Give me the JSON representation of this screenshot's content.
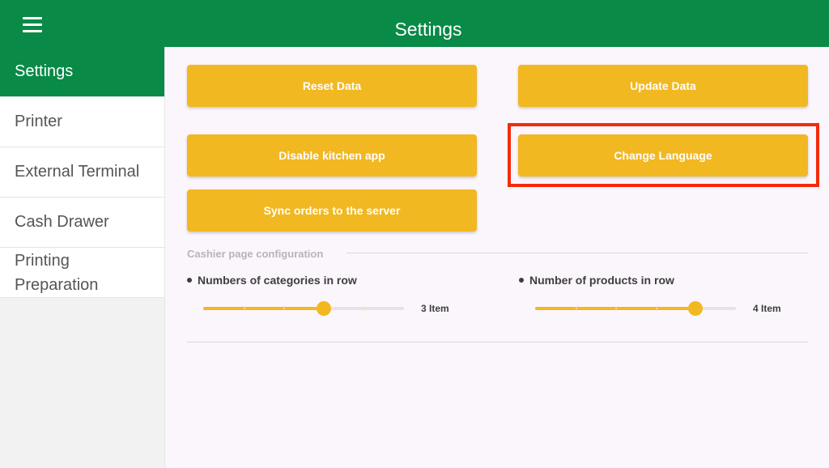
{
  "header": {
    "title": "Settings",
    "background_color": "#098a47",
    "menu_icon": "hamburger-menu-icon"
  },
  "sidebar": {
    "items": [
      {
        "label": "Settings",
        "active": true
      },
      {
        "label": "Printer",
        "active": false
      },
      {
        "label": "External Terminal",
        "active": false
      },
      {
        "label": "Cash Drawer",
        "active": false
      },
      {
        "label": "Printing Preparation",
        "active": false
      }
    ]
  },
  "actions": {
    "reset_data": "Reset Data",
    "update_data": "Update Data",
    "disable_kitchen_app": "Disable kitchen app",
    "change_language": "Change Language",
    "sync_orders": "Sync orders to the server",
    "button_color": "#f2b821",
    "highlight_color": "#f42a0c"
  },
  "cashier_config": {
    "section_title": "Cashier page configuration",
    "categories_setting": {
      "label": "Numbers of categories in row",
      "value_text": "3 Item",
      "level": 0.6
    },
    "products_setting": {
      "label": "Number of products in row",
      "value_text": "4 Item",
      "level": 0.8
    }
  }
}
